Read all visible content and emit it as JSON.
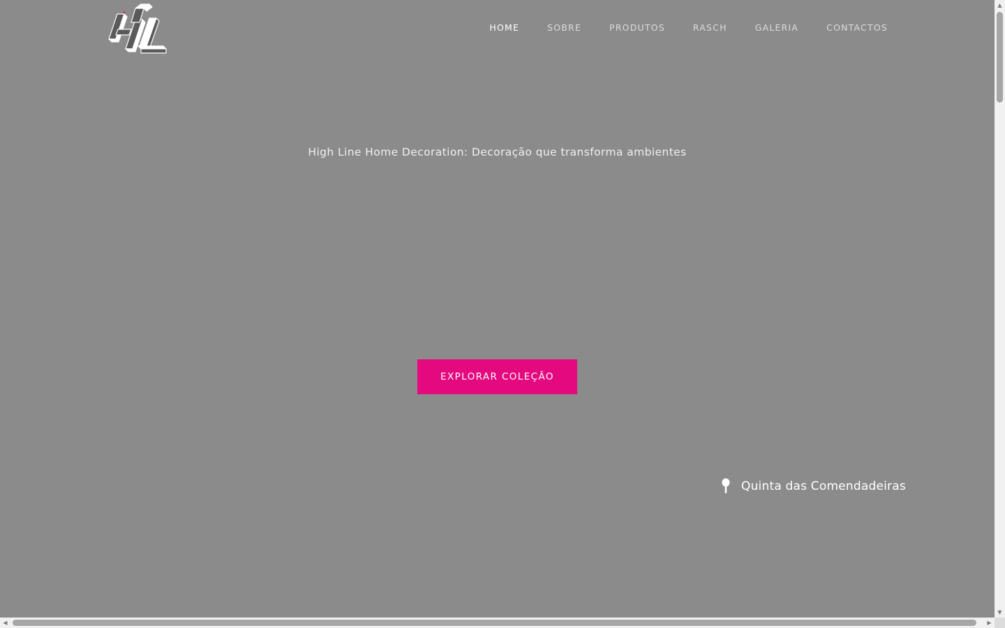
{
  "header": {
    "logo_icon": "hl-logo-icon",
    "nav": [
      {
        "label": "HOME",
        "active": true
      },
      {
        "label": "SOBRE"
      },
      {
        "label": "PRODUTOS"
      },
      {
        "label": "RASCH"
      },
      {
        "label": "GALERIA"
      },
      {
        "label": "CONTACTOS"
      }
    ]
  },
  "hero": {
    "tagline": "High Line Home Decoration: Decoração que transforma ambientes",
    "cta_label": "EXPLORAR COLEÇÃO",
    "location_icon": "map-pin-icon",
    "location": "Quinta das Comendadeiras"
  },
  "colors": {
    "background": "#8b8b8b",
    "accent": "#e5097f",
    "text": "#ffffff"
  },
  "scrollbars": {
    "up_arrow": "▲",
    "down_arrow": "▼",
    "left_arrow": "◀",
    "right_arrow": "▶"
  }
}
